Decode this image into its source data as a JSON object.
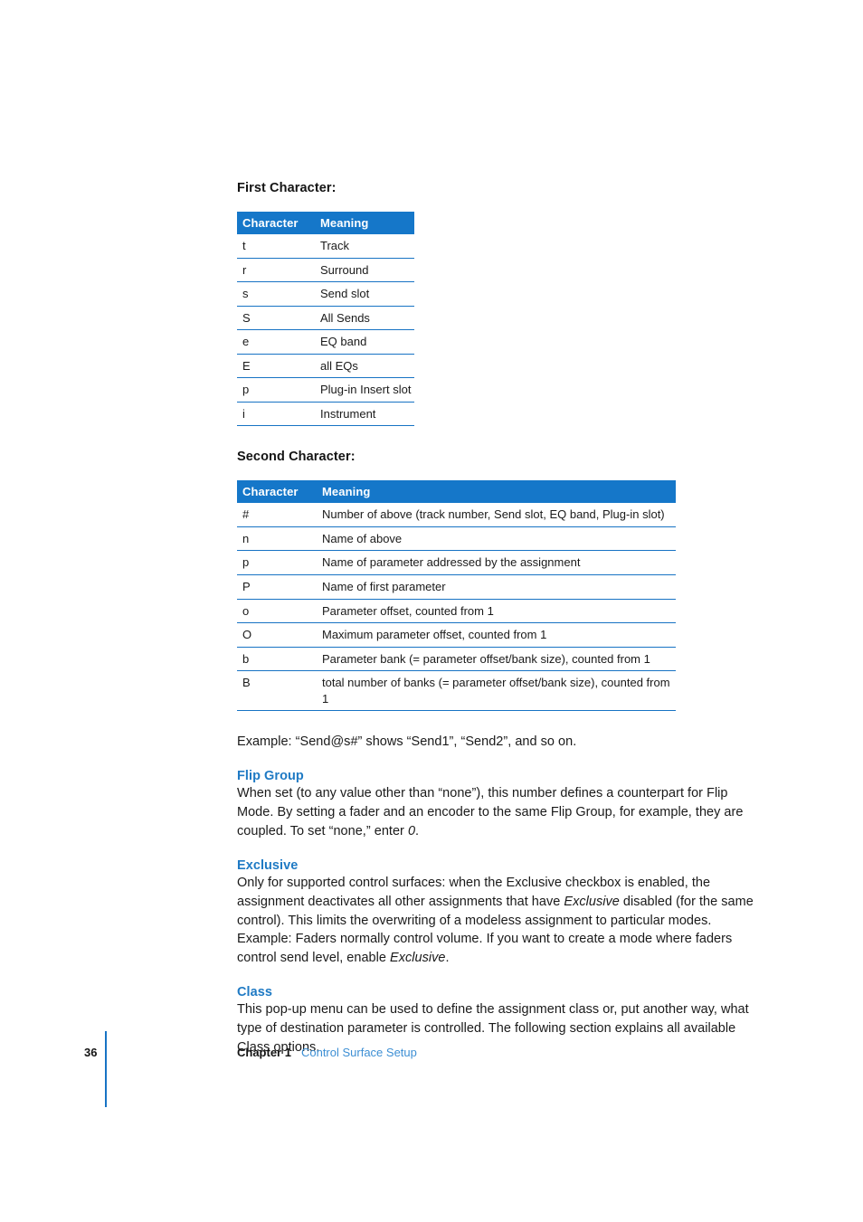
{
  "first_character": {
    "heading": "First Character:",
    "columns": [
      "Character",
      "Meaning"
    ],
    "rows": [
      {
        "character": "t",
        "meaning": "Track"
      },
      {
        "character": "r",
        "meaning": "Surround"
      },
      {
        "character": "s",
        "meaning": "Send slot"
      },
      {
        "character": "S",
        "meaning": "All Sends"
      },
      {
        "character": "e",
        "meaning": "EQ band"
      },
      {
        "character": "E",
        "meaning": "all EQs"
      },
      {
        "character": "p",
        "meaning": "Plug-in Insert slot"
      },
      {
        "character": "i",
        "meaning": "Instrument"
      }
    ]
  },
  "second_character": {
    "heading": "Second Character:",
    "columns": [
      "Character",
      "Meaning"
    ],
    "rows": [
      {
        "character": "#",
        "meaning": "Number of above (track number, Send slot, EQ band, Plug-in slot)"
      },
      {
        "character": "n",
        "meaning": "Name of above"
      },
      {
        "character": "p",
        "meaning": "Name of parameter addressed by the assignment"
      },
      {
        "character": "P",
        "meaning": "Name of first parameter"
      },
      {
        "character": "o",
        "meaning": "Parameter offset, counted from 1"
      },
      {
        "character": "O",
        "meaning": "Maximum parameter offset, counted from 1"
      },
      {
        "character": "b",
        "meaning": "Parameter bank (= parameter offset/bank size), counted from 1"
      },
      {
        "character": "B",
        "meaning": "total number of banks (= parameter offset/bank size), counted from 1"
      }
    ]
  },
  "example_line": "Example:  “Send@s#” shows “Send1”, “Send2”, and so on.",
  "sections": [
    {
      "title": "Flip Group",
      "paragraph_pre": "When set (to any value other than “none”), this number defines a counterpart for Flip Mode. By setting a fader and an encoder to the same Flip Group, for example, they are coupled. To set “none,” enter ",
      "paragraph_em": "0",
      "paragraph_post": "."
    },
    {
      "title": "Exclusive",
      "p1_pre": "Only for supported control surfaces:  when the Exclusive checkbox is enabled, the assignment deactivates all other assignments that have ",
      "p1_em": "Exclusive",
      "p1_mid": " disabled (for the same control). This limits the overwriting of a modeless assignment to particular modes. Example:  Faders normally control volume. If you want to create a mode where faders control send level, enable ",
      "p1_em2": "Exclusive",
      "p1_post": "."
    },
    {
      "title": "Class",
      "paragraph": "This pop-up menu can be used to define the assignment class or, put another way, what type of destination parameter is controlled. The following section explains all available Class options."
    }
  ],
  "footer": {
    "page_number": "36",
    "chapter_label": "Chapter 1",
    "chapter_title": "Control Surface Setup"
  },
  "colors": {
    "table_header_blue": "#1577c9",
    "rule_blue": "#1773c4",
    "heading_blue": "#1f7ac4",
    "footer_link_blue": "#3d8fd4",
    "text_black": "#1a1a1a"
  }
}
